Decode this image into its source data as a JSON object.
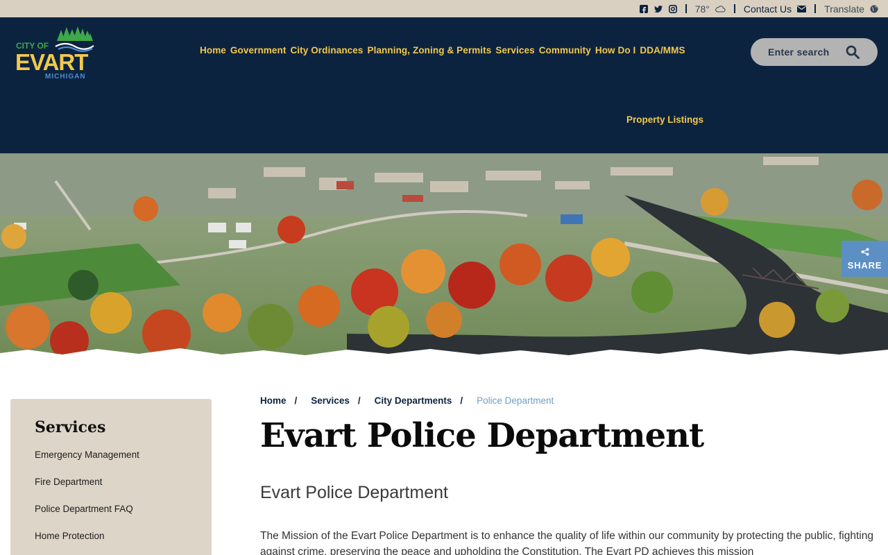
{
  "utility": {
    "social": [
      "facebook-icon",
      "twitter-icon",
      "instagram-icon"
    ],
    "temperature": "78°",
    "contact_label": "Contact Us",
    "translate_label": "Translate"
  },
  "logo": {
    "line1": "CITY OF",
    "line2": "EVART",
    "line3": "MICHIGAN"
  },
  "nav": {
    "items": [
      "Home",
      "Government",
      "City Ordinances",
      "Planning, Zoning & Permits",
      "Services",
      "Community",
      "How Do I",
      "DDA/MMS"
    ],
    "property_listings": "Property Listings"
  },
  "search": {
    "placeholder": "Enter search"
  },
  "share": {
    "label": "SHARE"
  },
  "sidebar": {
    "title": "Services",
    "links": [
      "Emergency Management",
      "Fire Department",
      "Police Department FAQ",
      "Home Protection"
    ]
  },
  "breadcrumb": {
    "items": [
      "Home",
      "Services",
      "City Departments"
    ],
    "separator": "/",
    "current": "Police Department"
  },
  "page": {
    "title": "Evart Police Department",
    "subtitle": "Evart Police Department",
    "body": "The Mission of the Evart Police Department is to enhance the quality of life within our community by protecting the public, fighting against crime, preserving the peace and upholding the Constitution. The Evart PD achieves this mission"
  },
  "colors": {
    "navy": "#0c2340",
    "gold": "#f2c94c",
    "tan": "#d9d0c1",
    "share_blue": "#5c90c4",
    "breadcrumb_current": "#6c9fc6"
  }
}
